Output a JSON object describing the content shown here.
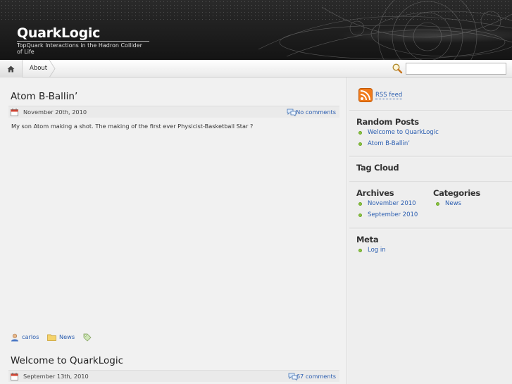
{
  "header": {
    "title": "QuarkLogic",
    "tagline": "TopQuark Interactions in the Hadron Collider of Life"
  },
  "nav": {
    "home_icon": "home-icon",
    "items": [
      {
        "label": "About"
      }
    ]
  },
  "search": {
    "icon": "magnifier-icon",
    "value": "",
    "placeholder": ""
  },
  "posts": [
    {
      "title": "Atom B-Ballin’",
      "date": "November 20th, 2010",
      "comments": "No comments",
      "body": "My son Atom making a shot. The making of the first ever Physicist-Basketball Star ?",
      "author": "carlos",
      "category": "News"
    },
    {
      "title": "Welcome to QuarkLogic",
      "date": "September 13th, 2010",
      "comments": "67 comments"
    }
  ],
  "sidebar": {
    "rss_label": "RSS feed",
    "random_posts": {
      "title": "Random Posts",
      "items": [
        "Welcome to QuarkLogic",
        "Atom B-Ballin’"
      ]
    },
    "tag_cloud": {
      "title": "Tag Cloud"
    },
    "archives": {
      "title": "Archives",
      "items": [
        "November 2010",
        "September 2010"
      ]
    },
    "categories": {
      "title": "Categories",
      "items": [
        "News"
      ]
    },
    "meta": {
      "title": "Meta",
      "items": [
        "Log in"
      ]
    }
  },
  "colors": {
    "link": "#2a5db0",
    "bullet": "#8cc63f",
    "rss": "#f07a1a"
  }
}
